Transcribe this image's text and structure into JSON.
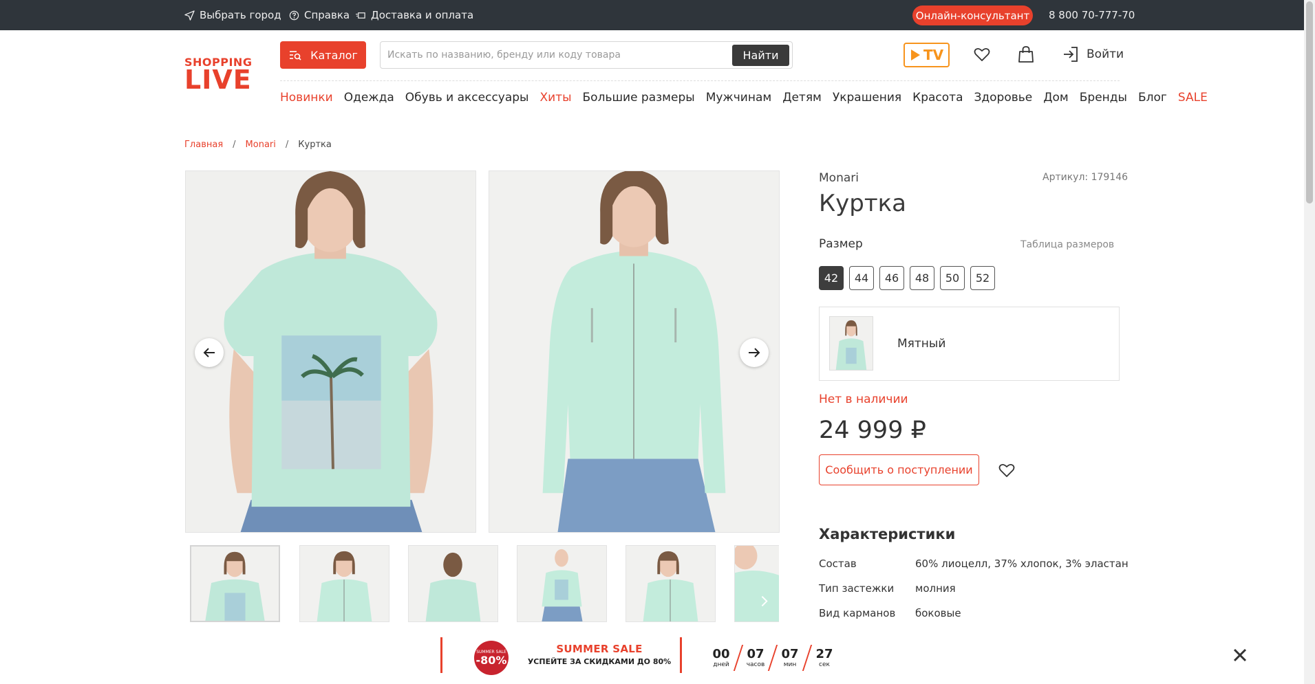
{
  "topbar": {
    "city": "Выбрать город",
    "help": "Справка",
    "delivery": "Доставка и оплата",
    "consultant": "Онлайн-консультант",
    "phone": "8 800 70-777-70"
  },
  "header": {
    "logo_line1": "SHOPPING",
    "logo_line2": "LIVE",
    "catalog": "Каталог",
    "search_placeholder": "Искать по названию, бренду или коду товара",
    "search_button": "Найти",
    "tv": "TV",
    "login": "Войти"
  },
  "nav": [
    {
      "label": "Новинки",
      "red": true
    },
    {
      "label": "Одежда",
      "red": false
    },
    {
      "label": "Обувь и аксессуары",
      "red": false
    },
    {
      "label": "Хиты",
      "red": true
    },
    {
      "label": "Большие размеры",
      "red": false
    },
    {
      "label": "Мужчинам",
      "red": false
    },
    {
      "label": "Детям",
      "red": false
    },
    {
      "label": "Украшения",
      "red": false
    },
    {
      "label": "Красота",
      "red": false
    },
    {
      "label": "Здоровье",
      "red": false
    },
    {
      "label": "Дом",
      "red": false
    },
    {
      "label": "Бренды",
      "red": false
    },
    {
      "label": "Блог",
      "red": false
    },
    {
      "label": "SALE",
      "red": true
    }
  ],
  "breadcrumb": {
    "home": "Главная",
    "brand": "Monari",
    "current": "Куртка",
    "separator": "/"
  },
  "product": {
    "brand": "Monari",
    "sku": "Артикул: 179146",
    "title": "Куртка",
    "size_label": "Размер",
    "size_table": "Таблица размеров",
    "sizes": [
      "42",
      "44",
      "46",
      "48",
      "50",
      "52"
    ],
    "selected_size": "42",
    "color": "Мятный",
    "stock": "Нет в наличии",
    "price": "24 999 ₽",
    "notify": "Сообщить о поступлении"
  },
  "specs": {
    "title": "Характеристики",
    "rows": [
      {
        "key": "Состав",
        "value": "60% лиоцелл, 37% хлопок, 3% эластан"
      },
      {
        "key": "Тип застежки",
        "value": "молния"
      },
      {
        "key": "Вид карманов",
        "value": "боковые"
      }
    ]
  },
  "promo": {
    "badge_small": "SUMMER SALE",
    "badge_big": "-80%",
    "title": "SUMMER SALE",
    "subtitle": "УСПЕЙТЕ ЗА СКИДКАМИ ДО 80%",
    "timer": [
      {
        "num": "00",
        "label": "дней"
      },
      {
        "num": "07",
        "label": "часов"
      },
      {
        "num": "07",
        "label": "мин"
      },
      {
        "num": "27",
        "label": "сек"
      }
    ]
  },
  "colors": {
    "accent": "#e8412c",
    "topbar": "#2f353b",
    "mint": "#bfeadb",
    "tv": "#f7941d"
  }
}
